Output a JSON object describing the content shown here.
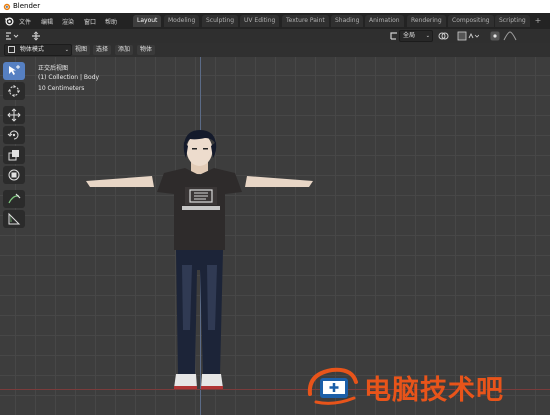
{
  "window": {
    "title": "Blender"
  },
  "menu": {
    "items": [
      "文件",
      "编辑",
      "渲染",
      "窗口",
      "帮助"
    ]
  },
  "workspaces": {
    "tabs": [
      "Layout",
      "Modeling",
      "Sculpting",
      "UV Editing",
      "Texture Paint",
      "Shading",
      "Animation",
      "Rendering",
      "Compositing",
      "Scripting"
    ],
    "active": "Layout",
    "add_label": "+"
  },
  "header": {
    "transform_orientation": "全局",
    "mode": "物体模式"
  },
  "header2": {
    "items": [
      "视图",
      "选择",
      "添加",
      "物体"
    ]
  },
  "viewport": {
    "view_name": "正交后视图",
    "collection": "(1) Collection | Body",
    "scale": "10 Centimeters"
  },
  "toolbar": {
    "tools": [
      "select-box",
      "cursor",
      "move",
      "rotate",
      "scale",
      "transform",
      "annotate",
      "measure"
    ]
  },
  "figure": {
    "shirt_print": "ILLUSION"
  },
  "watermark": {
    "text": "电脑技术吧"
  },
  "colors": {
    "accent": "#5680c2",
    "watermark": "#e8541a",
    "axis_x": "#7a3b3b",
    "axis_y": "#5b6b87"
  }
}
